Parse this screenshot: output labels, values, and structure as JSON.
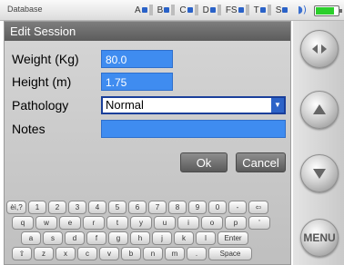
{
  "statusbar": {
    "app_name": "Database",
    "channels": [
      {
        "label": "A"
      },
      {
        "label": "B"
      },
      {
        "label": "C"
      },
      {
        "label": "D"
      },
      {
        "label": "FS"
      },
      {
        "label": "T"
      },
      {
        "label": "S"
      }
    ],
    "battery_level": 0.85,
    "battery_color": "#2bcf2b",
    "icons": [
      "signal-icon",
      "battery-icon"
    ]
  },
  "dialog": {
    "title": "Edit Session",
    "fields": {
      "weight": {
        "label": "Weight (Kg)",
        "value": "80.0"
      },
      "height": {
        "label": "Height (m)",
        "value": "1.75"
      },
      "pathology": {
        "label": "Pathology",
        "value": "Normal"
      },
      "notes": {
        "label": "Notes",
        "value": ""
      }
    },
    "ok_label": "Ok",
    "cancel_label": "Cancel"
  },
  "keyboard": {
    "rows": [
      [
        "èì,?",
        "1",
        "2",
        "3",
        "4",
        "5",
        "6",
        "7",
        "8",
        "9",
        "0",
        "-",
        "⇦"
      ],
      [
        "q",
        "w",
        "e",
        "r",
        "t",
        "y",
        "u",
        "i",
        "o",
        "p",
        "'"
      ],
      [
        "a",
        "s",
        "d",
        "f",
        "g",
        "h",
        "j",
        "k",
        "l",
        "Enter"
      ],
      [
        "⇧",
        "z",
        "x",
        "c",
        "v",
        "b",
        "n",
        "m",
        ".",
        "Space"
      ]
    ]
  },
  "sidepanel": {
    "buttons": [
      {
        "name": "swap-button",
        "icon": "swap-arrows-icon"
      },
      {
        "name": "up-button",
        "icon": "up-arrow-icon"
      },
      {
        "name": "down-button",
        "icon": "down-arrow-icon"
      },
      {
        "name": "menu-button",
        "label": "MENU"
      }
    ]
  },
  "colors": {
    "input_highlight": "#3f8cf0",
    "title_bar": "#6b6b6b",
    "select_arrow": "#2d63c8"
  }
}
